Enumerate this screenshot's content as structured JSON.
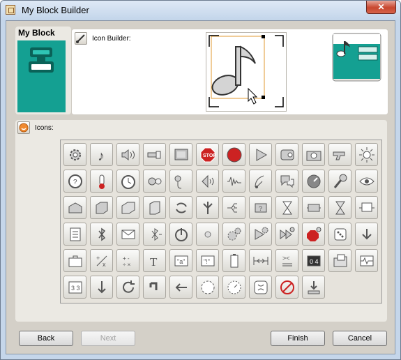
{
  "window": {
    "title": "My Block Builder",
    "close_glyph": "✕"
  },
  "myblock": {
    "label": "My Block",
    "icon": "my-block-icon"
  },
  "builder": {
    "label": "Icon Builder:",
    "canvas_icon": "music-note-icon",
    "preview_icon": "music-block-preview-icon"
  },
  "icons_section": {
    "label": "Icons:"
  },
  "icons": [
    "gear",
    "♪",
    "speaker",
    "lamp",
    "display",
    "stop-sign",
    "record",
    "play",
    "motor",
    "camera",
    "gun",
    "sun",
    "rotation",
    "thermo",
    "timer",
    "touch",
    "sound-sensor",
    "ultrasonic",
    "wave",
    "radar",
    "chat",
    "dial",
    "mic",
    "eye",
    "box-a",
    "box-b",
    "box-c",
    "box-d",
    "cycle",
    "branch",
    "switch-a",
    "switch-b",
    "hourglass-a",
    "loop",
    "hourglass-b",
    "screen-arrows",
    "list",
    "bluetooth",
    "envelope",
    "bt-send",
    "power",
    "dot",
    "gears",
    "play-gear",
    "ff-gear",
    "stop-gear",
    "dice",
    "down-arrow",
    "case",
    "pm",
    "calc",
    "T",
    "quote-a",
    "quote-x",
    "battery",
    "range",
    "compare",
    "number",
    "folder",
    "pulse",
    "3-3",
    "arrow-down",
    "refresh",
    "corner",
    "left",
    "gauge-a",
    "gauge-b",
    "gauge-c",
    "no",
    "download"
  ],
  "buttons": {
    "back": "Back",
    "next": "Next",
    "finish": "Finish",
    "cancel": "Cancel"
  },
  "colors": {
    "teal": "#14a092",
    "stop": "#cc2222"
  }
}
